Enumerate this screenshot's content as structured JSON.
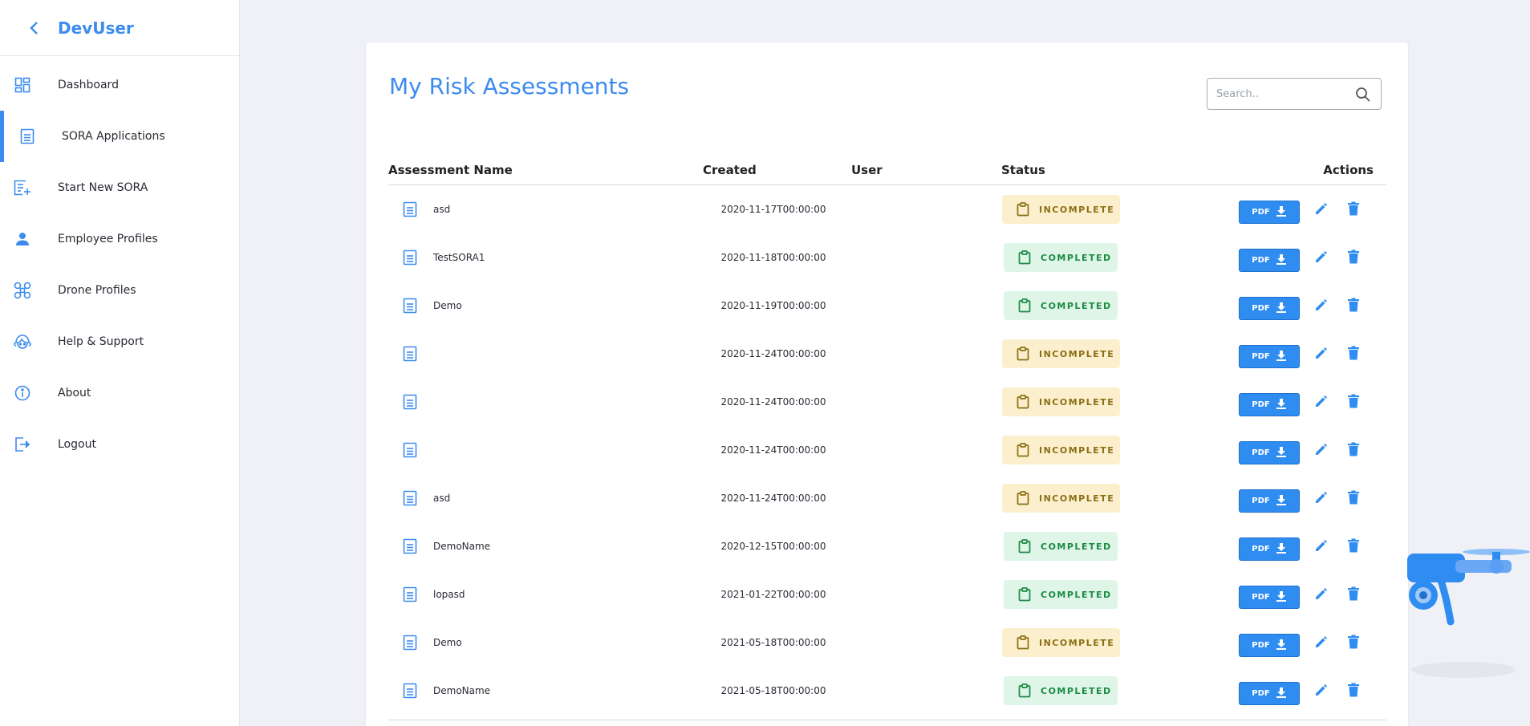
{
  "app": {
    "brand": "DevUser"
  },
  "sidebar": {
    "items": [
      {
        "label": "Dashboard",
        "icon": "dashboard-icon",
        "active": false
      },
      {
        "label": "SORA Applications",
        "icon": "document-icon",
        "active": true
      },
      {
        "label": "Start New SORA",
        "icon": "add-document-icon",
        "active": false
      },
      {
        "label": "Employee Profiles",
        "icon": "person-icon",
        "active": false
      },
      {
        "label": "Drone Profiles",
        "icon": "drone-icon",
        "active": false
      },
      {
        "label": "Help & Support",
        "icon": "support-icon",
        "active": false
      },
      {
        "label": "About",
        "icon": "info-icon",
        "active": false
      },
      {
        "label": "Logout",
        "icon": "logout-icon",
        "active": false
      }
    ]
  },
  "main": {
    "title": "My Risk Assessments",
    "search": {
      "placeholder": "Search..",
      "value": ""
    },
    "table": {
      "columns": [
        "Assessment Name",
        "Created",
        "User",
        "Status",
        "Actions"
      ],
      "pdf_label": "PDF",
      "rows": [
        {
          "name": "asd",
          "created": "2020-11-17T00:00:00",
          "user": "",
          "status": "INCOMPLETE"
        },
        {
          "name": "TestSORA1",
          "created": "2020-11-18T00:00:00",
          "user": "",
          "status": "COMPLETED"
        },
        {
          "name": "Demo",
          "created": "2020-11-19T00:00:00",
          "user": "",
          "status": "COMPLETED"
        },
        {
          "name": "",
          "created": "2020-11-24T00:00:00",
          "user": "",
          "status": "INCOMPLETE"
        },
        {
          "name": "",
          "created": "2020-11-24T00:00:00",
          "user": "",
          "status": "INCOMPLETE"
        },
        {
          "name": "",
          "created": "2020-11-24T00:00:00",
          "user": "",
          "status": "INCOMPLETE"
        },
        {
          "name": "asd",
          "created": "2020-11-24T00:00:00",
          "user": "",
          "status": "INCOMPLETE"
        },
        {
          "name": "DemoName",
          "created": "2020-12-15T00:00:00",
          "user": "",
          "status": "COMPLETED"
        },
        {
          "name": "lopasd",
          "created": "2021-01-22T00:00:00",
          "user": "",
          "status": "COMPLETED"
        },
        {
          "name": "Demo",
          "created": "2021-05-18T00:00:00",
          "user": "",
          "status": "INCOMPLETE"
        },
        {
          "name": "DemoName",
          "created": "2021-05-18T00:00:00",
          "user": "",
          "status": "COMPLETED"
        }
      ]
    }
  },
  "colors": {
    "accent": "#3d8bef",
    "incomplete_bg": "#fbefcd",
    "incomplete_text": "#8b6f14",
    "completed_bg": "#def5e7",
    "completed_text": "#1c8a45",
    "pdf_button": "#2f8cf0"
  }
}
